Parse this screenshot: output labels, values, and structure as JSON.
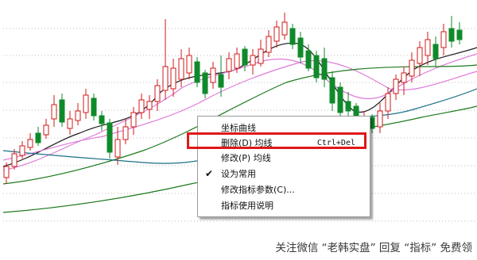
{
  "colors": {
    "candle_up": "#d21919",
    "candle_down": "#0f8a2a",
    "ma_fast": "#1a1a1a",
    "ma_pink": "#e07ad9",
    "ma_green": "#1c7a1c",
    "ma_blue": "#1a6f86",
    "menu_highlight": "#e01818"
  },
  "context_menu": {
    "items": [
      {
        "label": "坐标曲线",
        "shortcut": "",
        "checked": false
      },
      {
        "label": "删除(D) 均线",
        "shortcut": "Ctrl+Del",
        "checked": false
      },
      {
        "label": "修改(P) 均线",
        "shortcut": "",
        "checked": false
      },
      {
        "label": "设为常用",
        "shortcut": "",
        "checked": true
      },
      {
        "label": "修改指标参数(C)...",
        "shortcut": "",
        "checked": false
      },
      {
        "label": "指标使用说明",
        "shortcut": "",
        "checked": false
      }
    ]
  },
  "watermark": {
    "text": "关注微信 “老韩实盘” 回复 “指标” 免费领"
  }
}
